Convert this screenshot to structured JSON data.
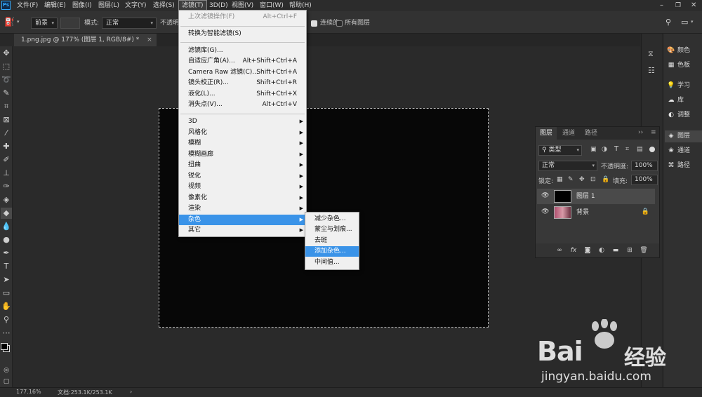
{
  "menubar": {
    "items": [
      "文件(F)",
      "编辑(E)",
      "图像(I)",
      "图层(L)",
      "文字(Y)",
      "选择(S)",
      "滤镜(T)",
      "3D(D)",
      "视图(V)",
      "窗口(W)",
      "帮助(H)"
    ]
  },
  "options": {
    "preset": "前景",
    "mode_label": "模式:",
    "mode_value": "正常",
    "opacity_label_partial": "不透明",
    "contiguous_label": "连续的",
    "all_layers_label": "所有图层"
  },
  "document_tab": {
    "title": "1.png.jpg @ 177% (图层 1, RGB/8#) *",
    "close": "×"
  },
  "filter_menu": {
    "last_filter": {
      "label": "上次滤镜操作(F)",
      "shortcut": "Alt+Ctrl+F"
    },
    "convert_smart": {
      "label": "转换为智能滤镜(S)"
    },
    "items_group1": [
      {
        "label": "滤镜库(G)...",
        "shortcut": ""
      },
      {
        "label": "自适应广角(A)...",
        "shortcut": "Alt+Shift+Ctrl+A"
      },
      {
        "label": "Camera Raw 滤镜(C)...",
        "shortcut": "Shift+Ctrl+A"
      },
      {
        "label": "镜头校正(R)...",
        "shortcut": "Shift+Ctrl+R"
      },
      {
        "label": "液化(L)...",
        "shortcut": "Shift+Ctrl+X"
      },
      {
        "label": "消失点(V)...",
        "shortcut": "Alt+Ctrl+V"
      }
    ],
    "submenus": [
      "3D",
      "风格化",
      "模糊",
      "模糊画廊",
      "扭曲",
      "锐化",
      "视频",
      "像素化",
      "渲染",
      "杂色",
      "其它"
    ],
    "active_submenu": "杂色"
  },
  "noise_menu": {
    "items": [
      "减少杂色...",
      "蒙尘与划痕...",
      "去斑",
      "添加杂色...",
      "中间值..."
    ],
    "highlighted": "添加杂色..."
  },
  "right_dock": {
    "group1": [
      "颜色",
      "色板"
    ],
    "group2": [
      "学习",
      "库",
      "调整"
    ],
    "group3": [
      "图层",
      "通道",
      "路径"
    ]
  },
  "layers_panel": {
    "tabs": [
      "图层",
      "通道",
      "路径"
    ],
    "filter_kind": "类型",
    "blend_mode": "正常",
    "opacity_label": "不透明度:",
    "opacity_value": "100%",
    "lock_label": "锁定:",
    "fill_label": "填充:",
    "fill_value": "100%",
    "layers": [
      {
        "name": "图层 1",
        "selected": true
      },
      {
        "name": "背景",
        "selected": false,
        "locked": true
      }
    ]
  },
  "status": {
    "zoom": "177.16%",
    "doc": "文档:253.1K/253.1K"
  },
  "watermark": {
    "brand_prefix": "Bai",
    "brand_suffix": "经验",
    "url": "jingyan.baidu.com"
  },
  "colors": {
    "highlight": "#3a93e8",
    "canvas": "#070707",
    "ps_blue": "#31a8ff"
  }
}
